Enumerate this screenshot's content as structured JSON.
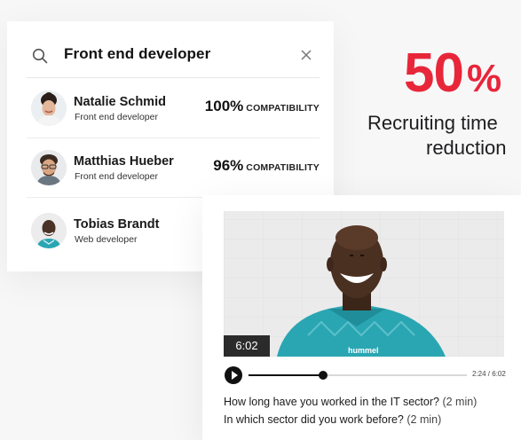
{
  "search": {
    "query": "Front end developer"
  },
  "candidates": [
    {
      "name": "Natalie Schmid",
      "role": "Front end developer",
      "compatibility_pct": "100%",
      "compatibility_label": "COMPATIBILITY"
    },
    {
      "name": "Matthias Hueber",
      "role": "Front end developer",
      "compatibility_pct": "96%",
      "compatibility_label": "COMPATIBILITY"
    },
    {
      "name": "Tobias Brandt",
      "role": "Web developer"
    }
  ],
  "stat": {
    "value": "50",
    "unit": "%",
    "line1": "Recruiting time",
    "line2": "reduction"
  },
  "video": {
    "duration_badge": "6:02",
    "time_readout": "2:24 / 6:02",
    "progress": 0.34,
    "jersey_text": "hummel"
  },
  "questions": [
    {
      "text": "How long have you worked in the IT sector?",
      "duration": "(2 min)"
    },
    {
      "text": "In which sector did you work before?",
      "duration": "(2 min)"
    }
  ],
  "colors": {
    "accent": "#e8263a",
    "text": "#1d1d1f",
    "jersey": "#2aa6b3"
  }
}
